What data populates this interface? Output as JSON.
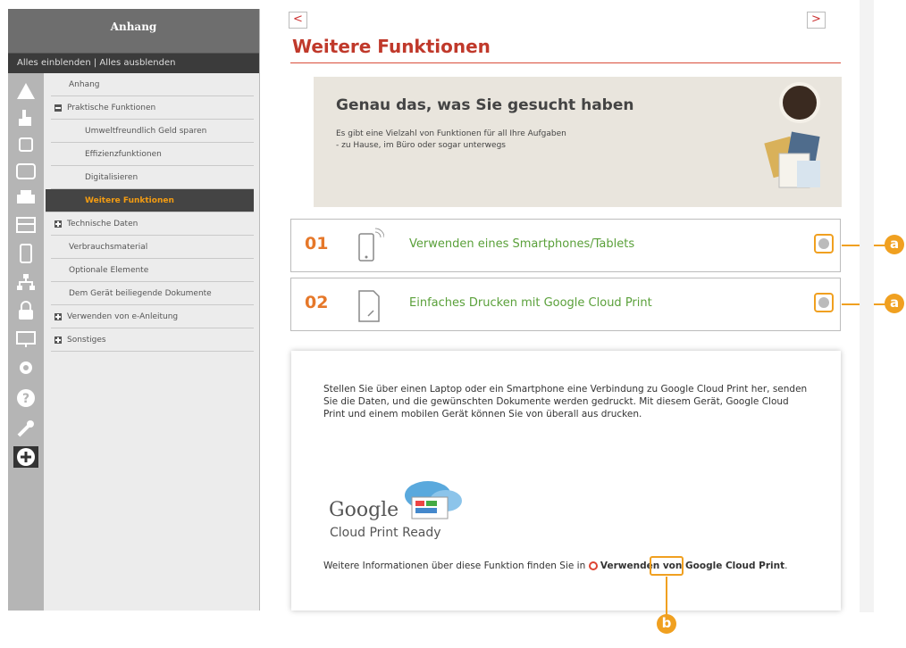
{
  "sidebar": {
    "header": "Anhang",
    "toggle": "Alles einblenden | Alles ausblenden",
    "items": [
      {
        "label": "Anhang",
        "level": 1,
        "expander": null
      },
      {
        "label": "Praktische Funktionen",
        "level": 0,
        "expander": "minus"
      },
      {
        "label": "Umweltfreundlich Geld sparen",
        "level": 2,
        "expander": null
      },
      {
        "label": "Effizienzfunktionen",
        "level": 2,
        "expander": null
      },
      {
        "label": "Digitalisieren",
        "level": 2,
        "expander": null
      },
      {
        "label": "Weitere Funktionen",
        "level": 2,
        "expander": null,
        "active": true
      },
      {
        "label": "Technische Daten",
        "level": 0,
        "expander": "plus"
      },
      {
        "label": "Verbrauchsmaterial",
        "level": 1,
        "expander": null
      },
      {
        "label": "Optionale Elemente",
        "level": 1,
        "expander": null
      },
      {
        "label": "Dem Gerät beiliegende Dokumente",
        "level": 1,
        "expander": null
      },
      {
        "label": "Verwenden von e-Anleitung",
        "level": 0,
        "expander": "plus"
      },
      {
        "label": "Sonstiges",
        "level": 0,
        "expander": "plus"
      }
    ],
    "icons": [
      "warning-icon",
      "hand-icon",
      "device-icon",
      "printer-panel-icon",
      "printer-icon",
      "scanner-icon",
      "mobile-icon",
      "network-icon",
      "lock-icon",
      "monitor-icon",
      "gear-icon",
      "help-icon",
      "wrench-icon",
      "plus-icon"
    ]
  },
  "nav": {
    "prev": "<",
    "next": ">"
  },
  "page_title": "Weitere Funktionen",
  "banner": {
    "heading": "Genau das, was Sie gesucht haben",
    "line1": "Es gibt eine Vielzahl von Funktionen für all Ihre Aufgaben",
    "line2": "- zu Hause, im Büro oder sogar unterwegs"
  },
  "accordion": [
    {
      "num": "01",
      "label": "Verwenden eines Smartphones/Tablets",
      "icon": "smartphone-icon",
      "callout": "a"
    },
    {
      "num": "02",
      "label": "Einfaches Drucken mit Google Cloud Print",
      "icon": "document-icon",
      "callout": "a"
    }
  ],
  "content": {
    "paragraph": "Stellen Sie über einen Laptop oder ein Smartphone eine Verbindung zu Google Cloud Print her, senden Sie die Daten, und die gewünschten Dokumente werden gedruckt. Mit diesem Gerät, Google Cloud Print und einem mobilen Gerät können Sie von überall aus drucken.",
    "logo_text": "Google",
    "logo_sub": "Cloud Print Ready",
    "more_prefix": "Weitere Informationen über diese Funktion finden Sie in",
    "more_link": "Verwenden von Google Cloud Print",
    "more_suffix": "."
  },
  "callouts": {
    "a": "a",
    "b": "b"
  },
  "colors": {
    "accent": "#c0392b",
    "orange": "#f0a020",
    "green": "#5aa03a",
    "num": "#e6782a"
  }
}
